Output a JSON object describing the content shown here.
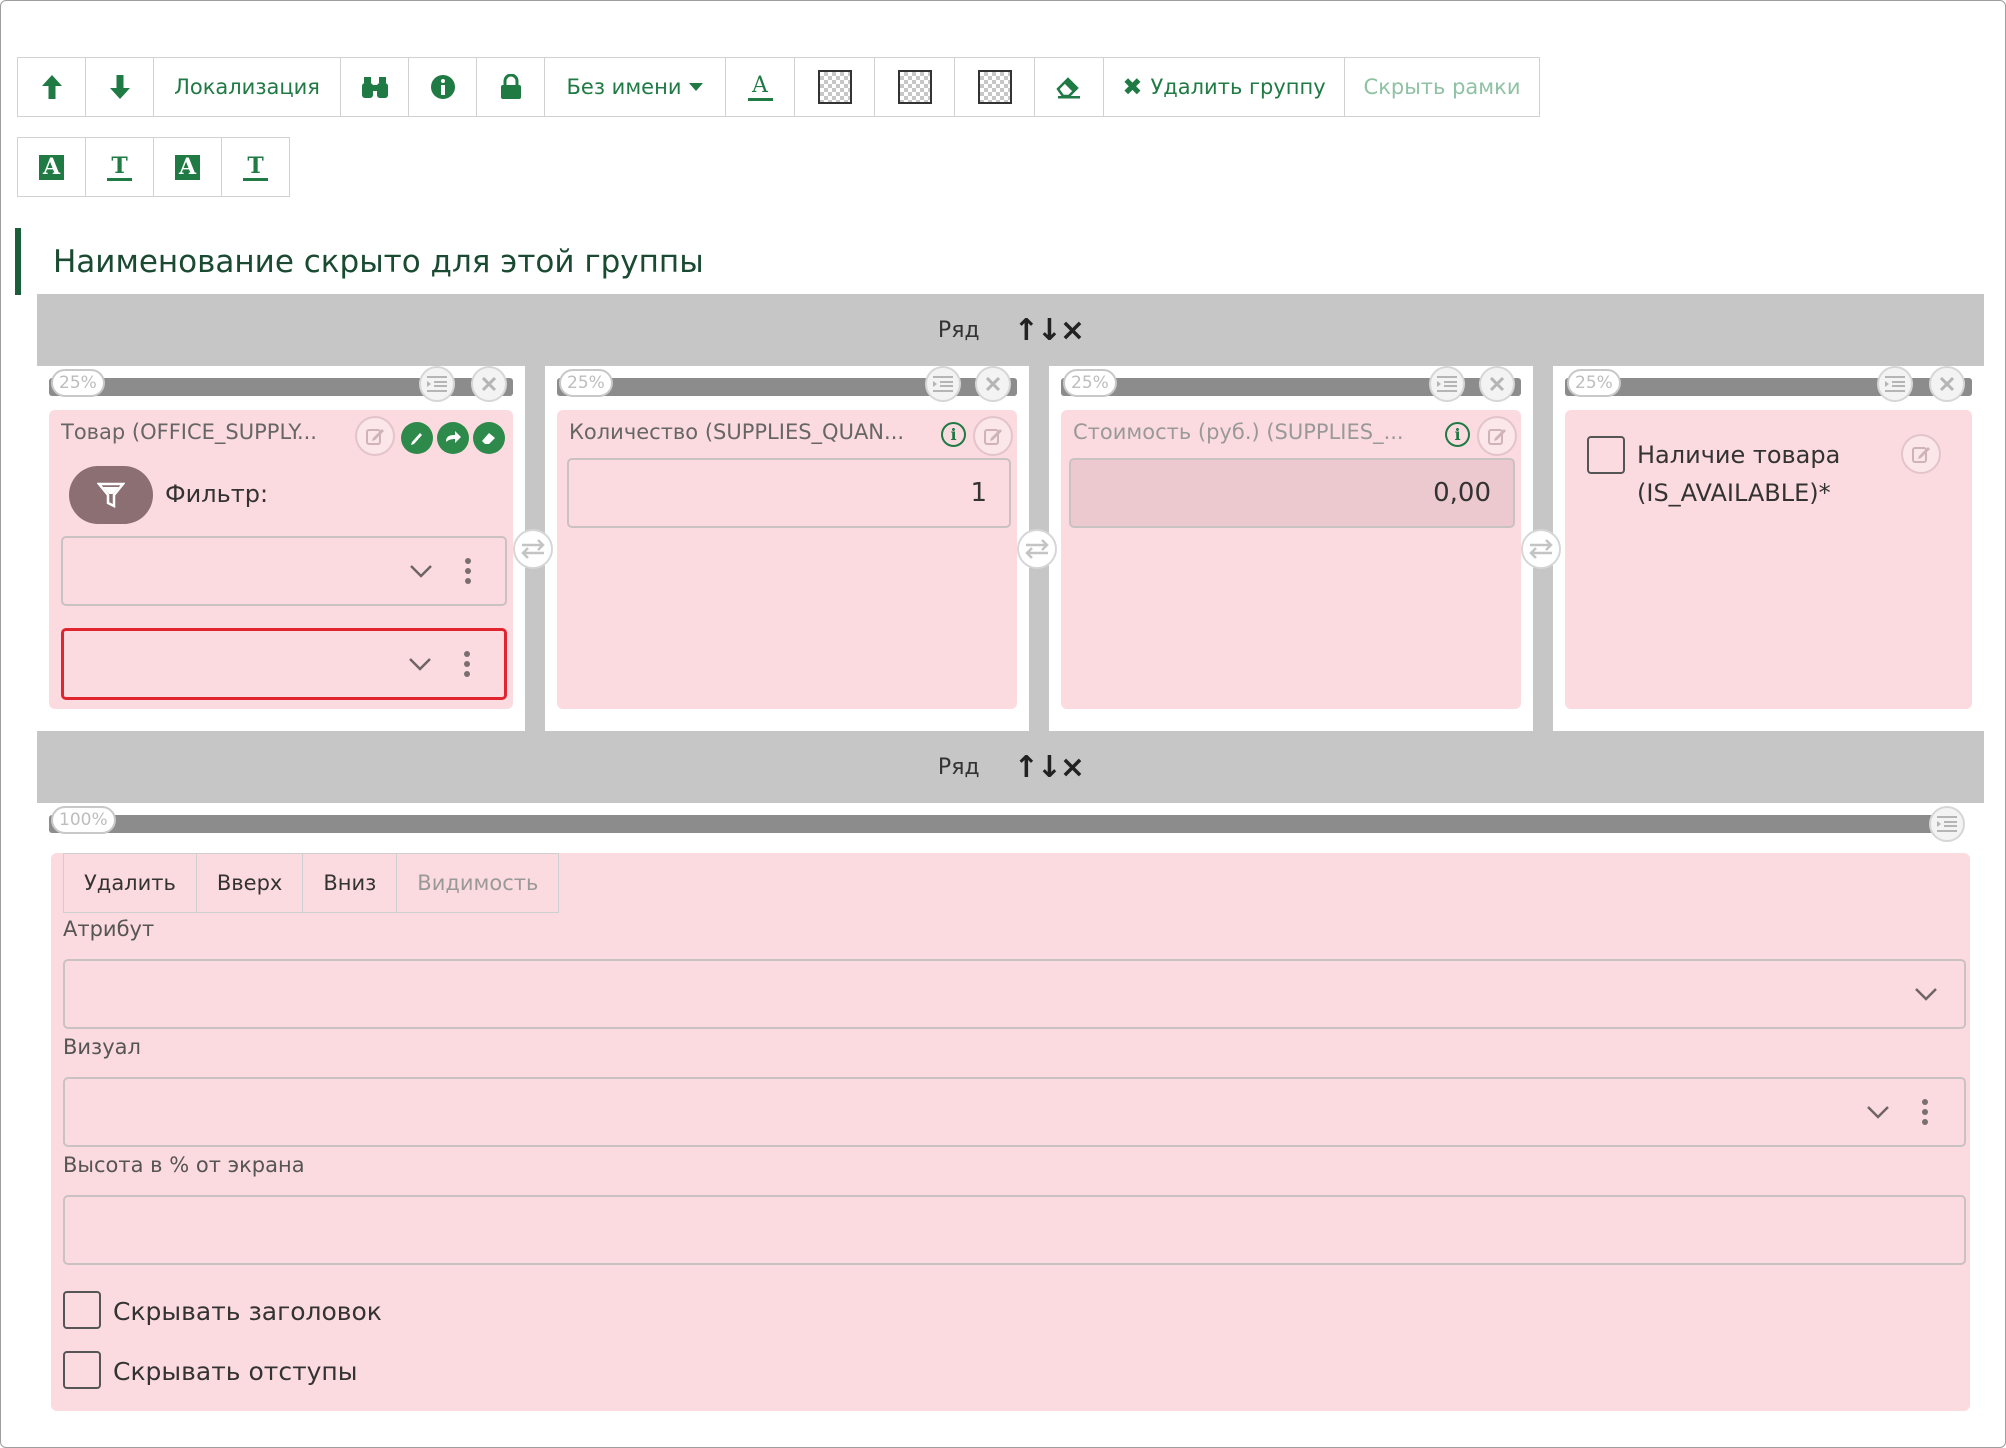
{
  "toolbar": {
    "localization_label": "Локализация",
    "name_dropdown_label": "Без имени",
    "delete_group_label": "Удалить группу",
    "hide_frames_label": "Скрыть рамки"
  },
  "group_heading": "Наименование скрыто для этой группы",
  "rows": [
    {
      "label": "Ряд",
      "arrows": "↑↓×",
      "columns": [
        {
          "width_pct": "25%",
          "title": "Товар (OFFICE_SUPPLY...",
          "filter_label": "Фильтр:"
        },
        {
          "width_pct": "25%",
          "title": "Количество (SUPPLIES_QUAN...",
          "value": "1"
        },
        {
          "width_pct": "25%",
          "title": "Стоимость (руб.) (SUPPLIES_...",
          "value": "0,00"
        },
        {
          "width_pct": "25%",
          "checkbox_label_line1": "Наличие товара",
          "checkbox_label_line2": "(IS_AVAILABLE)*"
        }
      ]
    },
    {
      "label": "Ряд",
      "arrows": "↑↓×",
      "column": {
        "width_pct": "100%",
        "buttons": [
          "Удалить",
          "Вверх",
          "Вниз",
          "Видимость"
        ],
        "attribute_label": "Атрибут",
        "visual_label": "Визуал",
        "height_label": "Высота в % от экрана",
        "hide_header_label": "Скрывать заголовок",
        "hide_padding_label": "Скрывать отступы"
      }
    }
  ],
  "colors": {
    "accent": "#1f7a44",
    "card_bg": "#fcdbe0",
    "row_bg": "#c6c6c6",
    "error_border": "#e0252f"
  },
  "icons": [
    "arrow-up-icon",
    "arrow-down-icon",
    "binoculars-icon",
    "info-icon",
    "lock-icon",
    "font-color-icon",
    "checker-icon",
    "eraser-icon",
    "close-icon",
    "edit-icon",
    "swap-icon",
    "filter-icon",
    "chevron-down-icon",
    "kebab-icon",
    "pencil-icon",
    "redirect-icon",
    "clear-icon",
    "list-icon"
  ]
}
